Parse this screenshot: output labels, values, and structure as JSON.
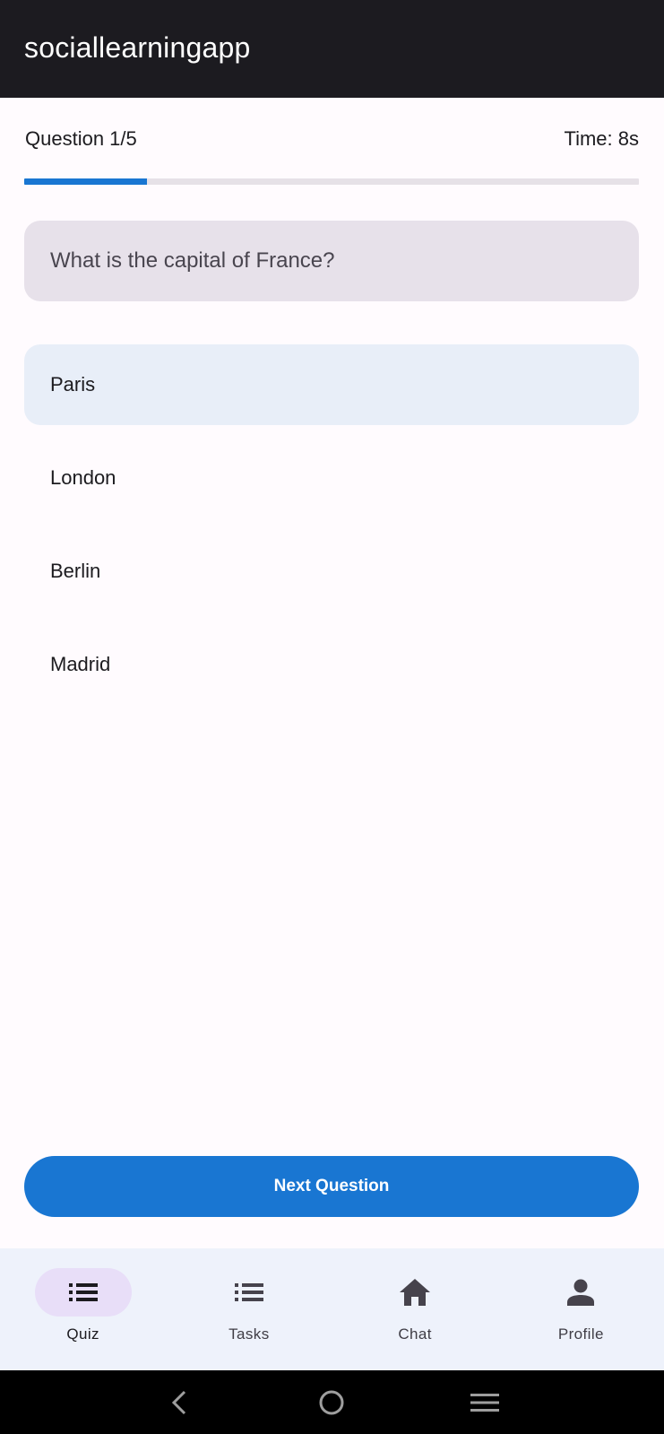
{
  "app": {
    "title": "sociallearningapp"
  },
  "quiz": {
    "counter": "Question 1/5",
    "timer": "Time: 8s",
    "progress": 0.2,
    "question": "What is the capital of France?",
    "options": [
      "Paris",
      "London",
      "Berlin",
      "Madrid"
    ],
    "selected_option": "Paris",
    "next_label": "Next Question"
  },
  "nav": {
    "items": [
      {
        "label": "Quiz",
        "icon": "list-icon",
        "active": true
      },
      {
        "label": "Tasks",
        "icon": "list-icon",
        "active": false
      },
      {
        "label": "Chat",
        "icon": "home-icon",
        "active": false
      },
      {
        "label": "Profile",
        "icon": "person-icon",
        "active": false
      }
    ]
  },
  "system_nav": {
    "icons": [
      "back-icon",
      "home-circle-icon",
      "recents-icon"
    ]
  },
  "colors": {
    "accent": "#1976d2",
    "appbar": "#1c1b20",
    "nav_bg": "#eef2fb",
    "active_pill": "#e8def8"
  }
}
